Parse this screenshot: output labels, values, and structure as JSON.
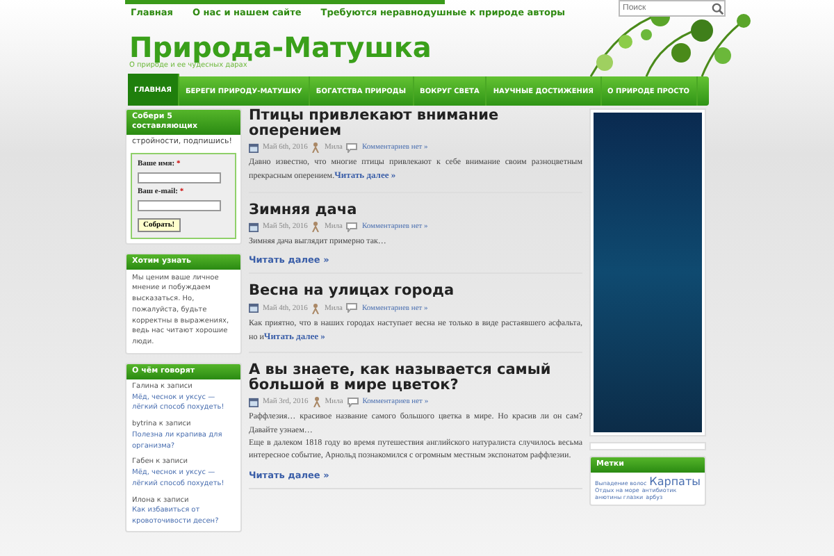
{
  "top_links": [
    "Главная",
    "О нас и нашем сайте",
    "Требуются неравнодушные к природе авторы"
  ],
  "search": {
    "placeholder": "Поиск"
  },
  "site": {
    "title": "Природа-Матушка",
    "tagline": "О природе и ее чудесных дарах"
  },
  "nav": [
    {
      "label": "ГЛАВНАЯ",
      "selected": true
    },
    {
      "label": "БЕРЕГИ ПРИРОДУ-МАТУШКУ",
      "selected": false
    },
    {
      "label": "БОГАТСТВА ПРИРОДЫ",
      "selected": false
    },
    {
      "label": "ВОКРУГ СВЕТА",
      "selected": false
    },
    {
      "label": "НАУЧНЫЕ ДОСТИЖЕНИЯ",
      "selected": false
    },
    {
      "label": "О ПРИРОДЕ ПРОСТО",
      "selected": false
    }
  ],
  "subscribe": {
    "title": "Собери 5 составляющих",
    "subtitle": "стройности, подпишись!",
    "name_label": "Ваше имя:",
    "email_label": "Ваш e-mail:",
    "required": "*",
    "button": "Собрать!"
  },
  "about": {
    "title": "Хотим узнать",
    "text": "Мы ценим ваше личное мнение и побуждаем высказаться. Но, пожалуйста, будьте корректны в выражениях, ведь нас читают хорошие люди."
  },
  "comments": {
    "title": "О чём говорят",
    "items": [
      {
        "author": "Галина",
        "joiner": "к записи",
        "post": "Мёд, чеснок и уксус — лёгкий способ похудеть!"
      },
      {
        "author": "bytrina",
        "joiner": "к записи",
        "post": "Полезна ли крапива для организма?"
      },
      {
        "author": "Габен",
        "joiner": "к записи",
        "post": "Мёд, чеснок и уксус — лёгкий способ похудеть!"
      },
      {
        "author": "Илона",
        "joiner": "к записи",
        "post": "Как избавиться от кровоточивости десен?"
      }
    ]
  },
  "posts": [
    {
      "title": "Птицы привлекают внимание оперением",
      "date": "Май 6th, 2016",
      "author": "Мила",
      "comments": "Комментариев нет »",
      "excerpt": [
        "Давно известно, что многие птицы привлекают к себе внимание своим разноцветным прекрасным оперением."
      ],
      "more": "Читать далее »",
      "more_inline": true
    },
    {
      "title": "Зимняя дача",
      "date": "Май 5th, 2016",
      "author": "Мила",
      "comments": "Комментариев нет »",
      "excerpt": [
        "Зимняя дача выглядит примерно так…"
      ],
      "more": "Читать далее »",
      "more_inline": false
    },
    {
      "title": "Весна на улицах города",
      "date": "Май 4th, 2016",
      "author": "Мила",
      "comments": "Комментариев нет »",
      "excerpt": [
        "Как приятно, что в наших городах наступает весна не только в виде растаявшего асфальта, но и"
      ],
      "more": "Читать далее »",
      "more_inline": true
    },
    {
      "title": "А вы знаете, как называется самый большой в мире цветок?",
      "date": "Май 3rd, 2016",
      "author": "Мила",
      "comments": "Комментариев нет »",
      "excerpt": [
        "Раффлезия… красивое название самого большого цветка в мире. Но красив ли он сам? Давайте узнаем…",
        "Еще в далеком 1818 году во время путешествия английского натуралиста случилось весьма интересное событие, Арнольд познакомился с огромным местным экспонатом раффлезии."
      ],
      "more": "Читать далее »",
      "more_inline": false
    }
  ],
  "tags": {
    "title": "Метки",
    "items": [
      {
        "label": "Выпадение волос",
        "big": false
      },
      {
        "label": "Карпаты",
        "big": true
      },
      {
        "label": "Отдых на море",
        "big": false
      },
      {
        "label": "антибиотик",
        "big": false
      },
      {
        "label": "анютины глазки",
        "big": false
      },
      {
        "label": "арбуз",
        "big": false
      }
    ]
  }
}
